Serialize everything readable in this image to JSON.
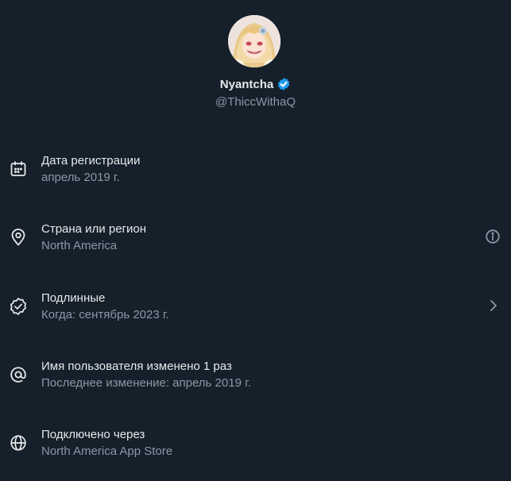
{
  "profile": {
    "display_name": "Nyantcha",
    "handle": "@ThiccWithaQ",
    "verified_icon": "verified-badge-icon",
    "avatar": "avatar-image"
  },
  "rows": [
    {
      "icon": "calendar-icon",
      "title": "Дата регистрации",
      "subtitle": "апрель 2019 г."
    },
    {
      "icon": "location-pin-icon",
      "title": "Страна или регион",
      "subtitle": "North America",
      "trailing_icon": "info-icon"
    },
    {
      "icon": "verified-check-icon",
      "title": "Подлинные",
      "subtitle": "Когда: сентябрь 2023 г.",
      "trailing_icon": "chevron-right-icon"
    },
    {
      "icon": "at-sign-icon",
      "title": "Имя пользователя изменено 1 раз",
      "subtitle": "Последнее изменение: апрель 2019 г."
    },
    {
      "icon": "globe-icon",
      "title": "Подключено через",
      "subtitle": "North America App Store"
    }
  ],
  "colors": {
    "background": "#15202b",
    "primary_text": "#e7e9ea",
    "secondary_text": "#8b98a5",
    "verified_blue": "#1d9bf0"
  }
}
